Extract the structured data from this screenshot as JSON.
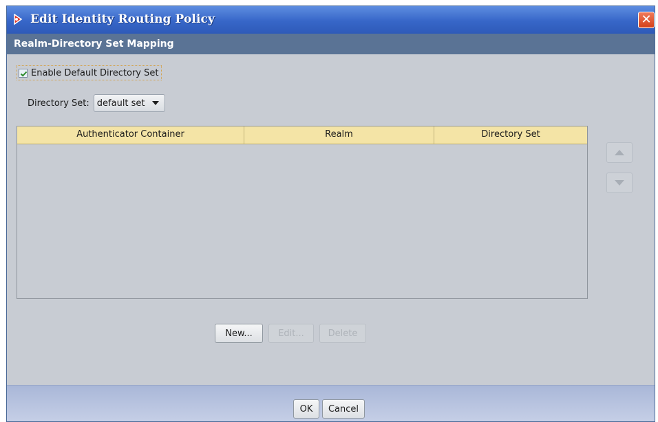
{
  "window": {
    "title": "Edit Identity Routing Policy",
    "close_glyph": "✕"
  },
  "section": {
    "header": "Realm-Directory Set Mapping"
  },
  "form": {
    "enable_default_label": "Enable Default Directory Set",
    "enable_default_checked": true,
    "directory_set_label": "Directory Set:",
    "directory_set_value": "default set"
  },
  "table": {
    "columns": [
      "Authenticator Container",
      "Realm",
      "Directory Set"
    ],
    "rows": []
  },
  "actions": {
    "new_label": "New...",
    "edit_label": "Edit...",
    "delete_label": "Delete"
  },
  "footer": {
    "ok_label": "OK",
    "cancel_label": "Cancel"
  },
  "icons": {
    "move_up": "arrow-up-icon",
    "move_down": "arrow-down-icon",
    "app": "app-logo-icon"
  },
  "colors": {
    "titlebar": "#3766c8",
    "section_header": "#5a7395",
    "table_header": "#f4e4a6",
    "body": "#c8ccd3",
    "footer": "#b8c3e0"
  }
}
